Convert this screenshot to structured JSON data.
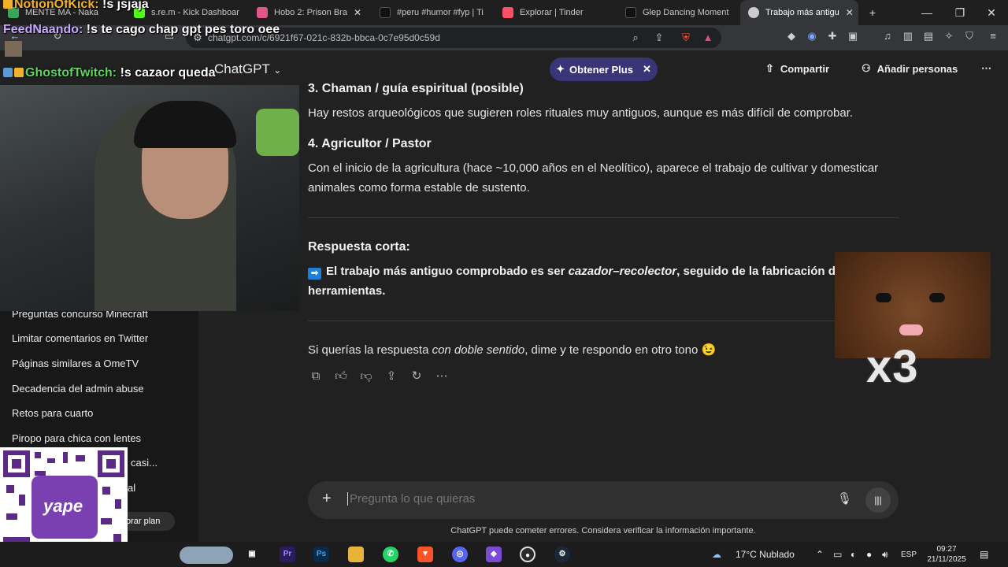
{
  "browser": {
    "tabs": [
      {
        "label": "MENTE MA - Naka",
        "favicon_color": "#3ba55c"
      },
      {
        "label": "s.re.m - Kick Dashboar",
        "favicon_color": "#53fc18"
      },
      {
        "label": "Hobo 2: Prison Bra",
        "favicon_color": "#e0558a"
      },
      {
        "label": "#peru #humor #fyp | Ti",
        "favicon_color": "#111111"
      },
      {
        "label": "Explorar | Tinder",
        "favicon_color": "#fd5068"
      },
      {
        "label": "Glep Dancing Moment",
        "favicon_color": "#111111"
      },
      {
        "label": "Trabajo más antigu",
        "favicon_color": "#cccccc"
      }
    ],
    "url": "chatgpt.com/c/6921f67-021c-832b-bbca-0c7e95d0c59d"
  },
  "header": {
    "model": "ChatGPT",
    "plus_label": "Obtener Plus",
    "share_label": "Compartir",
    "add_people_label": "Añadir personas"
  },
  "sidebar": {
    "items": [
      "Preguntas concurso Minecraft",
      "Limitar comentarios en Twitter",
      "Páginas similares a OmeTV",
      "Decadencia del admin abuse",
      "Retos para cuarto",
      "Piropo para chica con lentes",
      "casi...",
      "al"
    ],
    "upgrade_label": "orar plan"
  },
  "content": {
    "section3_heading": "3. Chaman / guía espiritual (posible)",
    "section3_text": "Hay restos arqueológicos que sugieren roles rituales muy antiguos, aunque es más difícil de comprobar.",
    "section4_heading": "4. Agricultor / Pastor",
    "section4_text": "Con el inicio de la agricultura (hace ~10,000 años en el Neolítico), aparece el trabajo de cultivar y domesticar animales como forma estable de sustento.",
    "short_answer_heading": "Respuesta corta:",
    "short_answer_part1": "El trabajo más antiguo comprobado es ser ",
    "short_answer_italic": "cazador–recolector",
    "short_answer_part2": ", seguido de la fabricación de herramientas.",
    "followup_part1": "Si querías la respuesta ",
    "followup_italic": "con doble sentido",
    "followup_part2": ", dime y te respondo en otro tono 😉"
  },
  "composer": {
    "placeholder": "Pregunta lo que quieras",
    "disclaimer": "ChatGPT puede cometer errores. Considera verificar la información importante."
  },
  "stream_chat": [
    {
      "user": "NotionOfKick:",
      "message": "!s jsjaja",
      "color": "#f3b12b"
    },
    {
      "user": "FeedNaando:",
      "message": "!s te cago chap gpt pes toro oee",
      "color": "#c9a8ff"
    },
    {
      "user": "GhostofTwitch:",
      "message": "!s cazaor queda",
      "color": "#5cd65c"
    }
  ],
  "overlay": {
    "sticker_text": "x3",
    "qr_label": "yape"
  },
  "taskbar": {
    "weather": "17°C  Nublado",
    "language": "ESP",
    "time": "09:27",
    "date": "21/11/2025"
  }
}
